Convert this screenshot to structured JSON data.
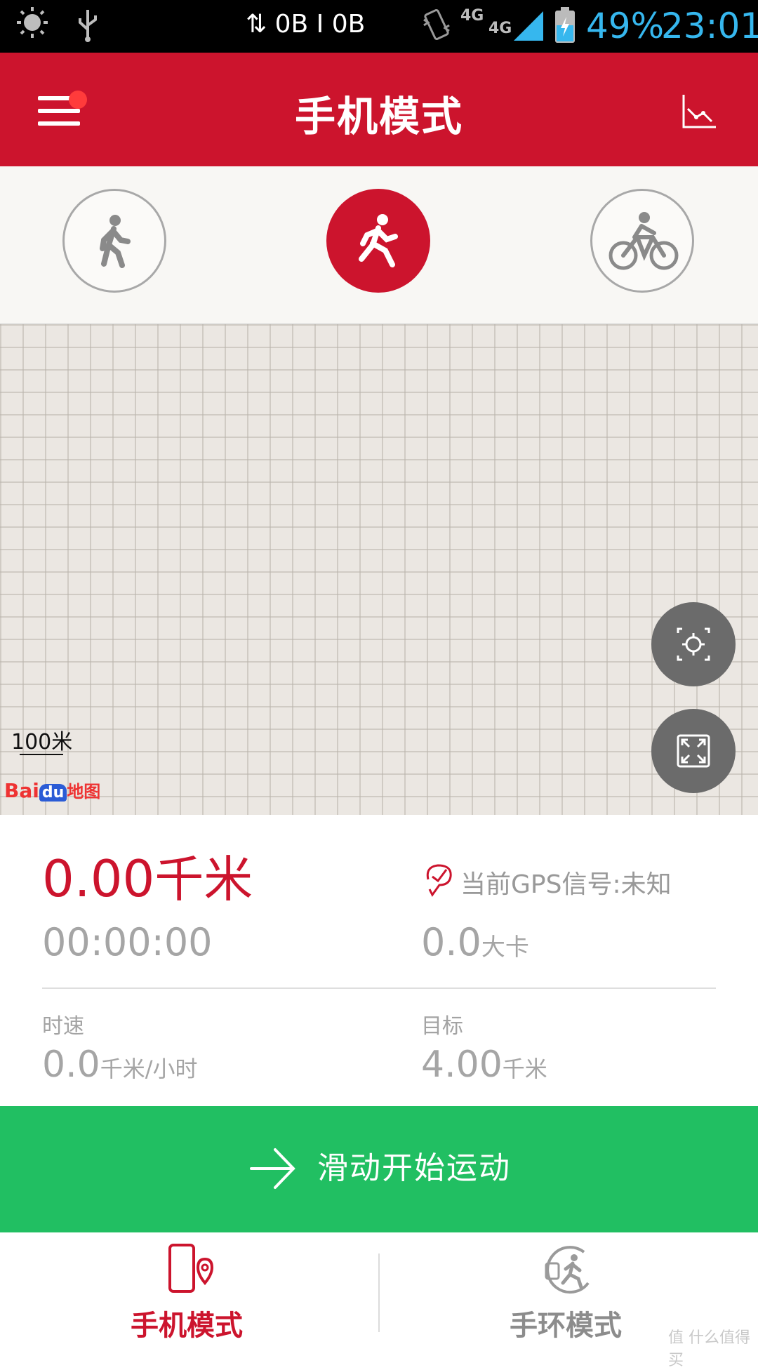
{
  "status_bar": {
    "network_speed": "⇅ 0B I 0B",
    "signal_4g_a": "4G",
    "signal_4g_b": "4G",
    "battery": "49%",
    "time": "23:01"
  },
  "header": {
    "title": "手机模式"
  },
  "modes": {
    "items": [
      "walk",
      "run",
      "bike"
    ],
    "active": "run"
  },
  "map": {
    "scale": "100米",
    "logo_text_a": "Bai",
    "logo_text_b": "du",
    "logo_text_c": "地图"
  },
  "stats": {
    "distance_value": "0.00",
    "distance_unit": "千米",
    "gps": "当前GPS信号:未知",
    "duration": "00:00:00",
    "calories_value": "0.0",
    "calories_unit": "大卡",
    "speed_label": "时速",
    "speed_value": "0.0",
    "speed_unit": "千米/小时",
    "target_label": "目标",
    "target_value": "4.00",
    "target_unit": "千米"
  },
  "start": {
    "label": "滑动开始运动"
  },
  "bottom_nav": {
    "phone_mode": "手机模式",
    "band_mode": "手环模式"
  },
  "watermark": "值 什么值得买",
  "colors": {
    "brand_red": "#cc142d",
    "start_green": "#21bf62",
    "status_blue": "#36b7ee"
  }
}
